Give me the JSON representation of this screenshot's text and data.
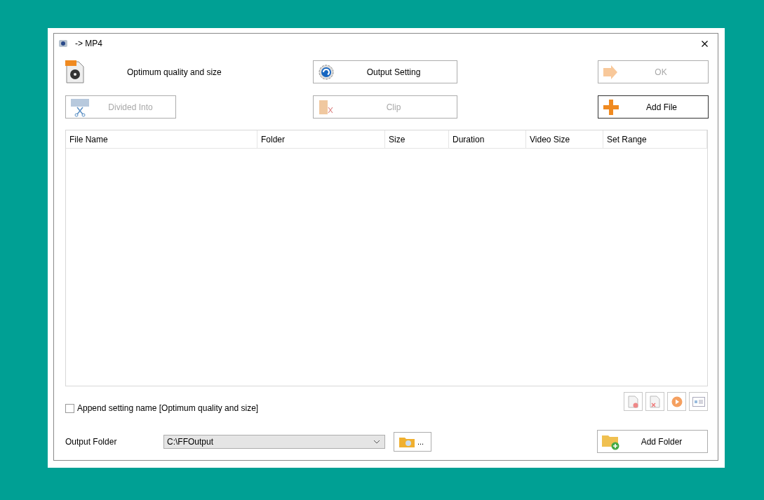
{
  "window": {
    "title": "-> MP4"
  },
  "preset": {
    "label": "Optimum quality and size"
  },
  "buttons": [
    {
      "kind": "output-setting",
      "label": "Output Setting",
      "disabled": false
    },
    {
      "kind": "ok",
      "label": "OK",
      "disabled": true
    },
    {
      "kind": "divide",
      "label": "Divided Into",
      "disabled": true
    },
    {
      "kind": "clip",
      "label": "Clip",
      "disabled": true
    },
    {
      "kind": "add-file",
      "label": "Add File",
      "disabled": false
    }
  ],
  "table": {
    "columns": [
      "File Name",
      "Folder",
      "Size",
      "Duration",
      "Video Size",
      "Set Range"
    ]
  },
  "append_setting": {
    "label": "Append setting name [Optimum quality and size]",
    "checked": false
  },
  "output_folder": {
    "label": "Output Folder",
    "value": "C:\\FFOutput",
    "browse_label": "..."
  },
  "add_folder": {
    "label": "Add Folder"
  }
}
